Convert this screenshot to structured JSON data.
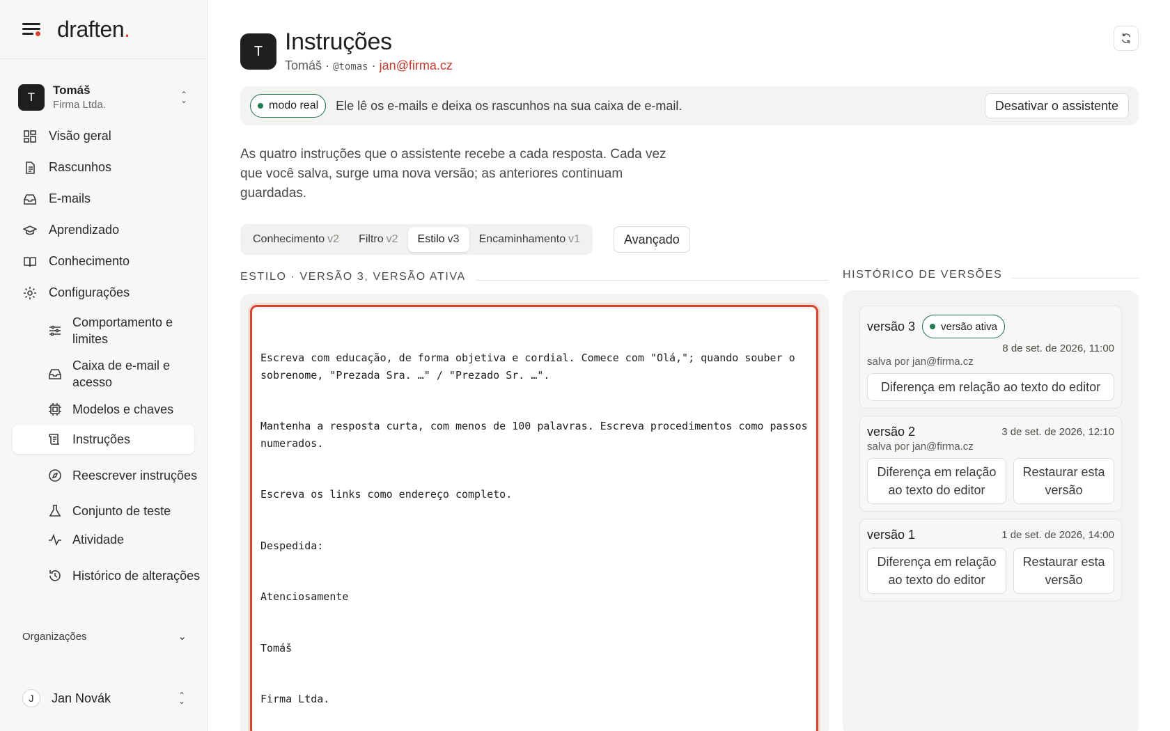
{
  "brand": {
    "name": "draften",
    "dot": "."
  },
  "workspace": {
    "initial": "T",
    "name": "Tomáš",
    "org": "Firma Ltda."
  },
  "nav": [
    {
      "label": "Visão geral",
      "icon": "dashboard-icon"
    },
    {
      "label": "Rascunhos",
      "icon": "document-icon"
    },
    {
      "label": "E-mails",
      "icon": "inbox-icon"
    },
    {
      "label": "Aprendizado",
      "icon": "graduation-cap-icon"
    },
    {
      "label": "Conhecimento",
      "icon": "book-icon"
    },
    {
      "label": "Configurações",
      "icon": "gear-icon"
    }
  ],
  "subnav": [
    {
      "label": "Comportamento e limites",
      "icon": "sliders-icon"
    },
    {
      "label": "Caixa de e-mail e acesso",
      "icon": "inbox-icon"
    },
    {
      "label": "Modelos e chaves",
      "icon": "chip-icon"
    },
    {
      "label": "Instruções",
      "icon": "scroll-icon",
      "active": true
    },
    {
      "label": "Reescrever instruções",
      "icon": "compass-icon"
    },
    {
      "label": "Conjunto de teste",
      "icon": "flask-icon"
    },
    {
      "label": "Atividade",
      "icon": "activity-icon"
    },
    {
      "label": "Histórico de alterações",
      "icon": "history-icon"
    }
  ],
  "orgs_label": "Organizações",
  "user": {
    "initial": "J",
    "name": "Jan Novák"
  },
  "header": {
    "initial": "T",
    "title": "Instruções",
    "name": "Tomáš",
    "sep": " · ",
    "handle": "@tomas",
    "email": "jan@firma.cz"
  },
  "banner": {
    "pill": "modo real",
    "text": "Ele lê os e-mails e deixa os rascunhos na sua caixa de e-mail.",
    "button": "Desativar o assistente"
  },
  "description": "As quatro instruções que o assistente recebe a cada resposta. Cada vez que você salva, surge uma nova versão; as anteriores continuam guardadas.",
  "tabs": [
    {
      "label": "Conhecimento",
      "version": "v2"
    },
    {
      "label": "Filtro",
      "version": "v2"
    },
    {
      "label": "Estilo",
      "version": "v3",
      "active": true
    },
    {
      "label": "Encaminhamento",
      "version": "v1"
    }
  ],
  "advanced_label": "Avançado",
  "editor": {
    "section_label": "Estilo · Versão 3, versão ativa",
    "lines": [
      "Escreva com educação, de forma objetiva e cordial. Comece com \"Olá,\"; quando souber o sobrenome, \"Prezada Sra. …\" / \"Prezado Sr. …\".",
      "Mantenha a resposta curta, com menos de 100 palavras. Escreva procedimentos como passos numerados.",
      "Escreva os links como endereço completo.",
      "Despedida:",
      "Atenciosamente",
      "Tomáš",
      "Firma Ltda."
    ]
  },
  "history": {
    "section_label": "Histórico de versões",
    "active_badge": "versão ativa",
    "versions": [
      {
        "label": "versão 3",
        "date": "8 de set. de 2026, 11:00",
        "saved_by": "salva por jan@firma.cz",
        "diff": "Diferença em relação ao texto do editor"
      },
      {
        "label": "versão 2",
        "date": "3 de set. de 2026, 12:10",
        "saved_by": "salva por jan@firma.cz",
        "diff": "Diferença em relação ao texto do editor",
        "restore": "Restaurar esta versão"
      },
      {
        "label": "versão 1",
        "date": "1 de set. de 2026, 14:00",
        "diff": "Diferença em relação ao texto do editor",
        "restore": "Restaurar esta versão"
      }
    ]
  },
  "colors": {
    "accent": "#d9422b",
    "active_green": "#1e7d4f",
    "dark": "#1f1f1f"
  }
}
